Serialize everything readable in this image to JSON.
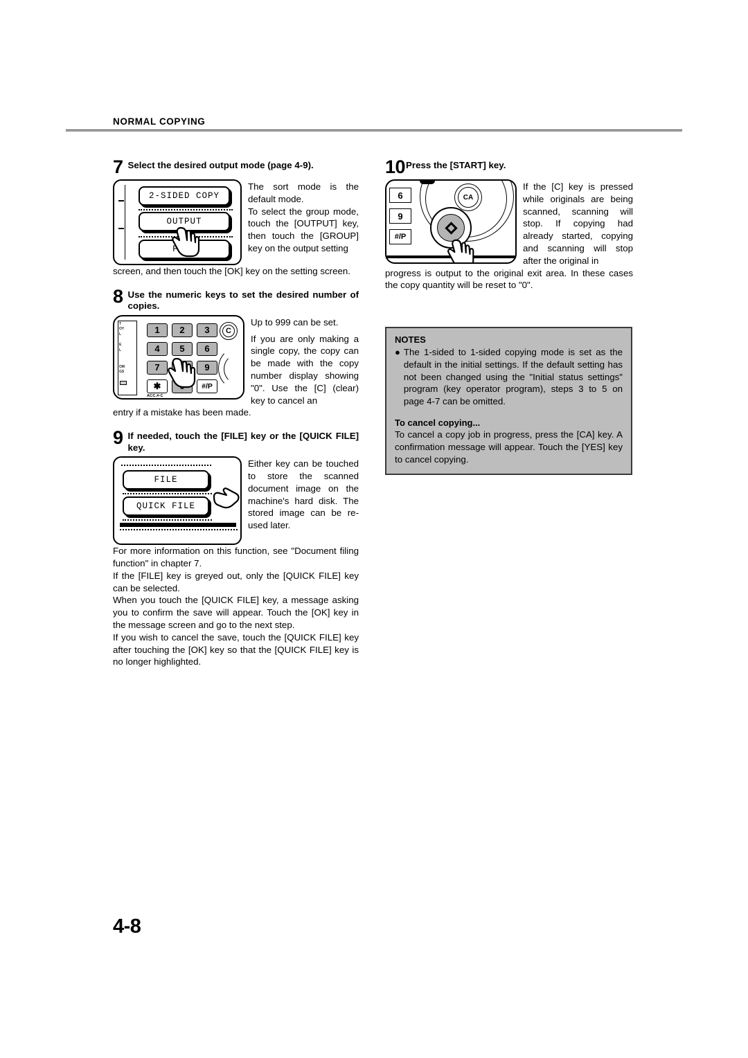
{
  "header": {
    "title": "NORMAL COPYING"
  },
  "footer": {
    "page_number": "4-8"
  },
  "steps": {
    "step7": {
      "number": "7",
      "title": "Select the desired output mode (page 4-9).",
      "panel_buttons": [
        "2-SIDED COPY",
        "OUTPUT",
        "FILE"
      ],
      "side_text": "The sort mode is the default mode.\nTo select the group mode, touch the [OUTPUT] key, then touch the [GROUP] key on the output setting",
      "side_text_1": "The sort mode is the default mode.",
      "side_text_2": "To select the group mode, touch the [OUTPUT] key, then touch the [GROUP] key on the output setting",
      "below_text": "screen, and then touch the [OK] key on the setting screen."
    },
    "step8": {
      "number": "8",
      "title": "Use the numeric keys to set the desired number of copies.",
      "keys": [
        "1",
        "2",
        "3",
        "4",
        "5",
        "6",
        "7",
        "9",
        "✱",
        "0",
        "#/P"
      ],
      "clear_key": "C",
      "acc_label": "ACC.#-C",
      "side_text_1": "Up to 999 can be set.",
      "side_text_2": "If you are only making a single copy, the copy can be made with the copy number display showing \"0\". Use the [C] (clear) key to cancel an",
      "below_text": "entry if a mistake has been made."
    },
    "step9": {
      "number": "9",
      "title": "If needed, touch the [FILE] key or the [QUICK FILE] key.",
      "panel_buttons": [
        "FILE",
        "QUICK FILE"
      ],
      "side_text": "Either key can be touched to store the scanned document image on the machine's hard disk. The stored image can be re-used later.",
      "paragraphs": [
        "For more information on this function, see \"Document filing function\" in chapter 7.",
        "If the [FILE] key is greyed out, only the [QUICK FILE] key can be selected.",
        "When you touch the [QUICK FILE] key, a message asking you to confirm the save will appear. Touch the [OK] key in the message screen and go to the next step.",
        "If you wish to cancel the save, touch the [QUICK FILE] key after touching the [OK] key so that the [QUICK FILE] key is no longer highlighted."
      ]
    },
    "step10": {
      "number": "10",
      "title": "Press the [START] key.",
      "panel_keys": [
        "6",
        "9",
        "#/P"
      ],
      "ca_key": "CA",
      "start_key_icon": "start-diamond",
      "side_text": "If the [C] key is pressed while originals are being scanned, scanning will stop. If copying had already started, copying and scanning will stop after the original in",
      "below_text": "progress is output to the original exit area. In these cases the copy quantity will be reset to \"0\"."
    }
  },
  "notes": {
    "title": "NOTES",
    "bullet": "●",
    "item1": "The 1-sided to 1-sided copying mode is set as the default in the initial settings. If the default setting has not been changed using the \"Initial status settings\" program (key operator program), steps 3 to 5 on page 4-7 can be omitted.",
    "subtitle": "To cancel copying...",
    "body": "To cancel a copy job in progress, press the [CA] key. A confirmation message will appear. Touch the [YES] key to cancel copying."
  },
  "colors": {
    "notes_background": "#bdbdbd",
    "key_gray": "#b4b4b4",
    "rule": "#4a4a4a"
  }
}
